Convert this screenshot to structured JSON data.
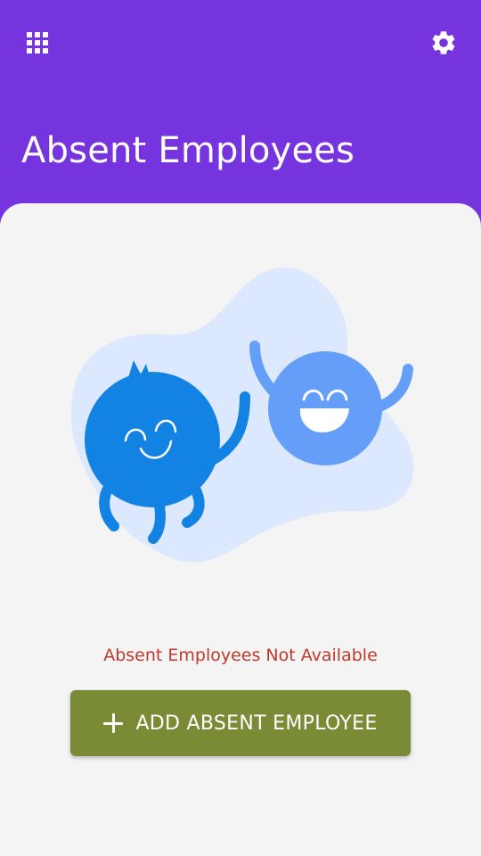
{
  "theme": {
    "brand": "#7534dd",
    "sheet_bg": "#f4f4f4",
    "error_text": "#c0392b",
    "primary_button": "#7a8b36",
    "character_dark": "#1283e2",
    "character_light": "#649ef8",
    "blob": "#dce8fd"
  },
  "header": {
    "apps_icon": "grid-icon",
    "settings_icon": "gear-icon",
    "title": "Absent Employees"
  },
  "empty_state": {
    "message": "Absent Employees Not Available",
    "illustration": "two-happy-characters"
  },
  "actions": {
    "add_icon": "plus-icon",
    "add_label": "ADD ABSENT EMPLOYEE"
  }
}
